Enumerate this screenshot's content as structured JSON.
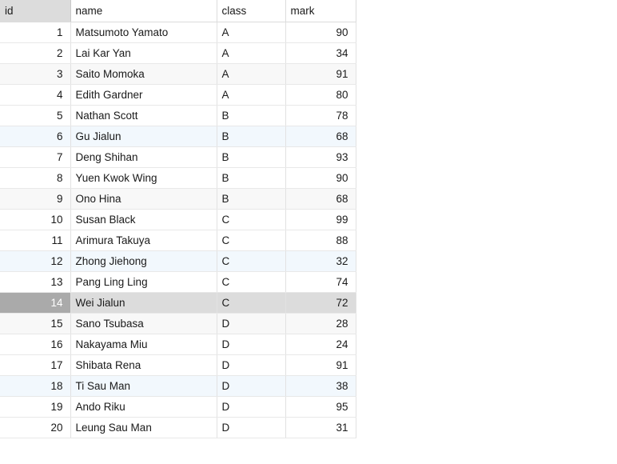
{
  "table": {
    "name": "student-marks-grid",
    "columns": [
      {
        "key": "id",
        "label": "id",
        "align": "right"
      },
      {
        "key": "name",
        "label": "name",
        "align": "left"
      },
      {
        "key": "class",
        "label": "class",
        "align": "left"
      },
      {
        "key": "mark",
        "label": "mark",
        "align": "right"
      }
    ],
    "header_id_background": "#dcdcdc",
    "selected_row_id": 14,
    "selected_id_background": "#aaaaaa",
    "selected_row_background": "#dcdcdc",
    "tint_gray": "#f8f8f8",
    "tint_blue": "#f2f8fd",
    "row_count": 20,
    "rows": [
      {
        "id": "1",
        "name": "Matsumoto Yamato",
        "class": "A",
        "mark": "90",
        "tint": "none",
        "selected": false
      },
      {
        "id": "2",
        "name": "Lai Kar Yan",
        "class": "A",
        "mark": "34",
        "tint": "none",
        "selected": false
      },
      {
        "id": "3",
        "name": "Saito Momoka",
        "class": "A",
        "mark": "91",
        "tint": "gray",
        "selected": false
      },
      {
        "id": "4",
        "name": "Edith Gardner",
        "class": "A",
        "mark": "80",
        "tint": "none",
        "selected": false
      },
      {
        "id": "5",
        "name": "Nathan Scott",
        "class": "B",
        "mark": "78",
        "tint": "none",
        "selected": false
      },
      {
        "id": "6",
        "name": "Gu Jialun",
        "class": "B",
        "mark": "68",
        "tint": "blue",
        "selected": false
      },
      {
        "id": "7",
        "name": "Deng Shihan",
        "class": "B",
        "mark": "93",
        "tint": "none",
        "selected": false
      },
      {
        "id": "8",
        "name": "Yuen Kwok Wing",
        "class": "B",
        "mark": "90",
        "tint": "none",
        "selected": false
      },
      {
        "id": "9",
        "name": "Ono Hina",
        "class": "B",
        "mark": "68",
        "tint": "gray",
        "selected": false
      },
      {
        "id": "10",
        "name": "Susan Black",
        "class": "C",
        "mark": "99",
        "tint": "none",
        "selected": false
      },
      {
        "id": "11",
        "name": "Arimura Takuya",
        "class": "C",
        "mark": "88",
        "tint": "none",
        "selected": false
      },
      {
        "id": "12",
        "name": "Zhong Jiehong",
        "class": "C",
        "mark": "32",
        "tint": "blue",
        "selected": false
      },
      {
        "id": "13",
        "name": "Pang Ling Ling",
        "class": "C",
        "mark": "74",
        "tint": "none",
        "selected": false
      },
      {
        "id": "14",
        "name": "Wei Jialun",
        "class": "C",
        "mark": "72",
        "tint": "none",
        "selected": true
      },
      {
        "id": "15",
        "name": "Sano Tsubasa",
        "class": "D",
        "mark": "28",
        "tint": "gray",
        "selected": false
      },
      {
        "id": "16",
        "name": "Nakayama Miu",
        "class": "D",
        "mark": "24",
        "tint": "none",
        "selected": false
      },
      {
        "id": "17",
        "name": "Shibata Rena",
        "class": "D",
        "mark": "91",
        "tint": "none",
        "selected": false
      },
      {
        "id": "18",
        "name": "Ti Sau Man",
        "class": "D",
        "mark": "38",
        "tint": "blue",
        "selected": false
      },
      {
        "id": "19",
        "name": "Ando Riku",
        "class": "D",
        "mark": "95",
        "tint": "none",
        "selected": false
      },
      {
        "id": "20",
        "name": "Leung Sau Man",
        "class": "D",
        "mark": "31",
        "tint": "none",
        "selected": false
      }
    ]
  }
}
